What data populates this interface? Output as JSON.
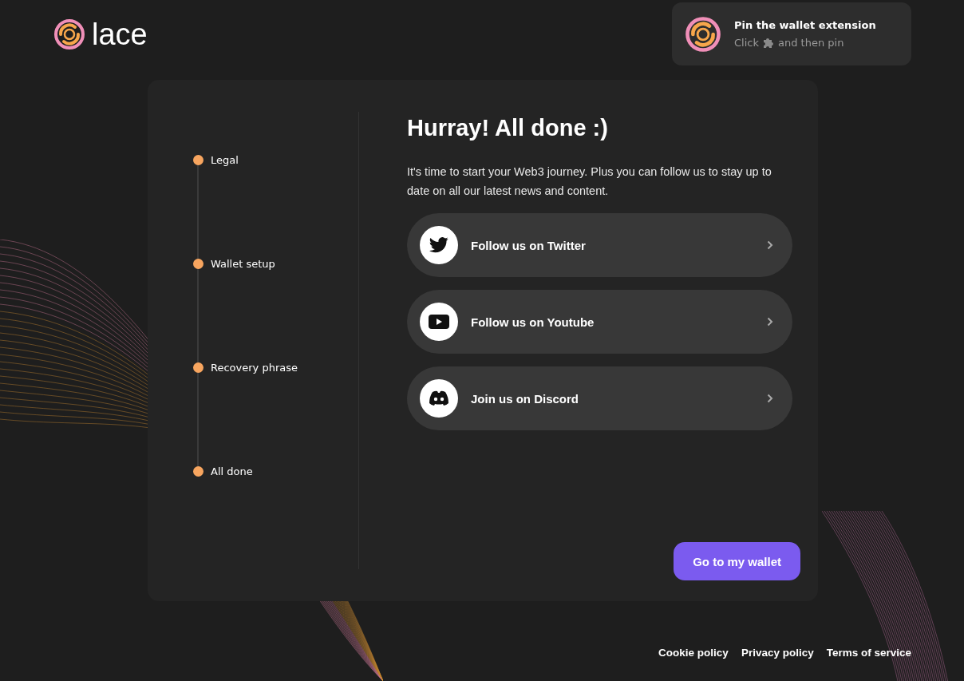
{
  "brand": {
    "name": "lace"
  },
  "pin_notice": {
    "title": "Pin the wallet extension",
    "text_before": "Click",
    "text_after": "and then pin"
  },
  "steps": [
    {
      "label": "Legal"
    },
    {
      "label": "Wallet setup"
    },
    {
      "label": "Recovery phrase"
    },
    {
      "label": "All done"
    }
  ],
  "content": {
    "title": "Hurray! All done :)",
    "description": "It's time to start your Web3 journey. Plus you can follow us to stay up to date on all our latest news and content."
  },
  "social_links": [
    {
      "kind": "twitter",
      "label": "Follow us on Twitter"
    },
    {
      "kind": "youtube",
      "label": "Follow us on Youtube"
    },
    {
      "kind": "discord",
      "label": "Join us on Discord"
    }
  ],
  "primary_button": "Go to my wallet",
  "footer_links": [
    "Cookie policy",
    "Privacy policy",
    "Terms of service"
  ]
}
